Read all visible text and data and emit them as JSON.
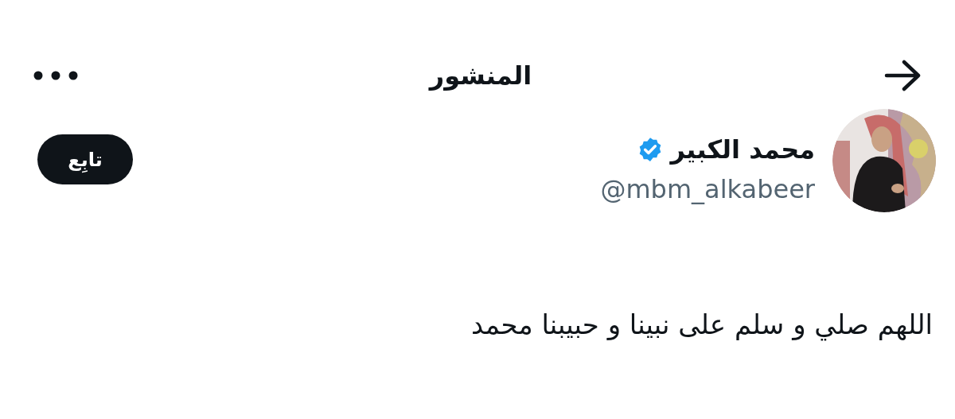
{
  "header": {
    "title": "المنشور"
  },
  "author": {
    "name": "محمد الكبير",
    "verified": true,
    "handle": "@mbm_alkabeer"
  },
  "follow_button": {
    "label": "تابِع"
  },
  "post": {
    "text": "اللهم صلي و سلم على نبينا و حبيبنا محمد"
  }
}
